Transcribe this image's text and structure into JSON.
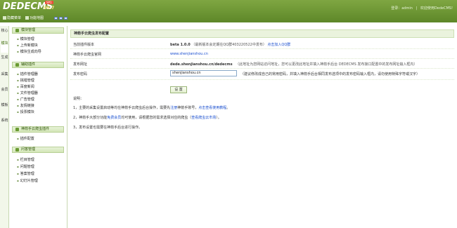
{
  "header": {
    "logo_text": "DEDECMS",
    "version": "V5.7",
    "badge": "SP1",
    "right_links": [
      "登录：admin",
      "|",
      "欢迎使用DedeCMS!"
    ],
    "subbar": {
      "hide_menu": "隐藏菜单",
      "function_map": "功能地图"
    },
    "colors": {
      "green": "#6b9a33"
    }
  },
  "vtabs": [
    "核心",
    "模块",
    "生成",
    "采集",
    "会员",
    "模板",
    "系统"
  ],
  "sidebar": {
    "groups": [
      {
        "title": "模块管理",
        "items": [
          "模块管理",
          "上传新模块",
          "模块生成向导"
        ]
      },
      {
        "title": "辅助插件",
        "items": [
          "插件管理器",
          "挑错管理",
          "百度新闻",
          "文件管理器",
          "广告管理",
          "友情链接",
          "投票模块"
        ]
      },
      {
        "title": "神箭手云爬虫插件",
        "items": [
          "插件配置"
        ]
      },
      {
        "title": "问答管理",
        "items": [
          "栏目管理",
          "问题管理",
          "答案管理",
          "幻灯片管理"
        ]
      }
    ]
  },
  "main": {
    "panel_title": "神箭手云爬虫发布配置",
    "rows": [
      {
        "label": "当前插件版本",
        "value": "beta 1.0.0",
        "note": "（最新版本会定期在QQ群403220522中发布）",
        "link": "点击加入QQ群"
      },
      {
        "label": "神箭手云爬虫官网",
        "value": "www.shenjianshou.cn"
      },
      {
        "label": "发布网址",
        "value": "dede.shenjianshou.cn/dedecms",
        "note": "（此地址为您网站访问地址，您可以更改此地址并填入神箭手后台 DEDECMS 发布接口配置中的发布网址输入框内）"
      },
      {
        "label": "发布密码",
        "input_value": "shenjianshou.cn",
        "note": "（建议修改成自己的常用密码，并填入神箭手后台相同发布选项中的发布密码输入框内，请勿使用特殊字符或汉字）"
      }
    ],
    "button_label": "设 置",
    "notes_title": "说明：",
    "notes": [
      {
        "prefix": "1，主要的采集设置启动等均在神箭手云爬虫后台操作，需要先",
        "link1": "注册",
        "middle": "神箭手账号，",
        "link2": "点击查看使用教程",
        "suffix": "。"
      },
      {
        "prefix": "2，神箭手大部分功能",
        "link1": "免费会员",
        "middle": "均可使用，请根据您的需求选择对应的爬虫（",
        "link2": "查看爬虫云市场",
        "suffix": "）。"
      },
      {
        "prefix": "3，发布设置也需要在神箭手后台进行操作。"
      }
    ]
  }
}
